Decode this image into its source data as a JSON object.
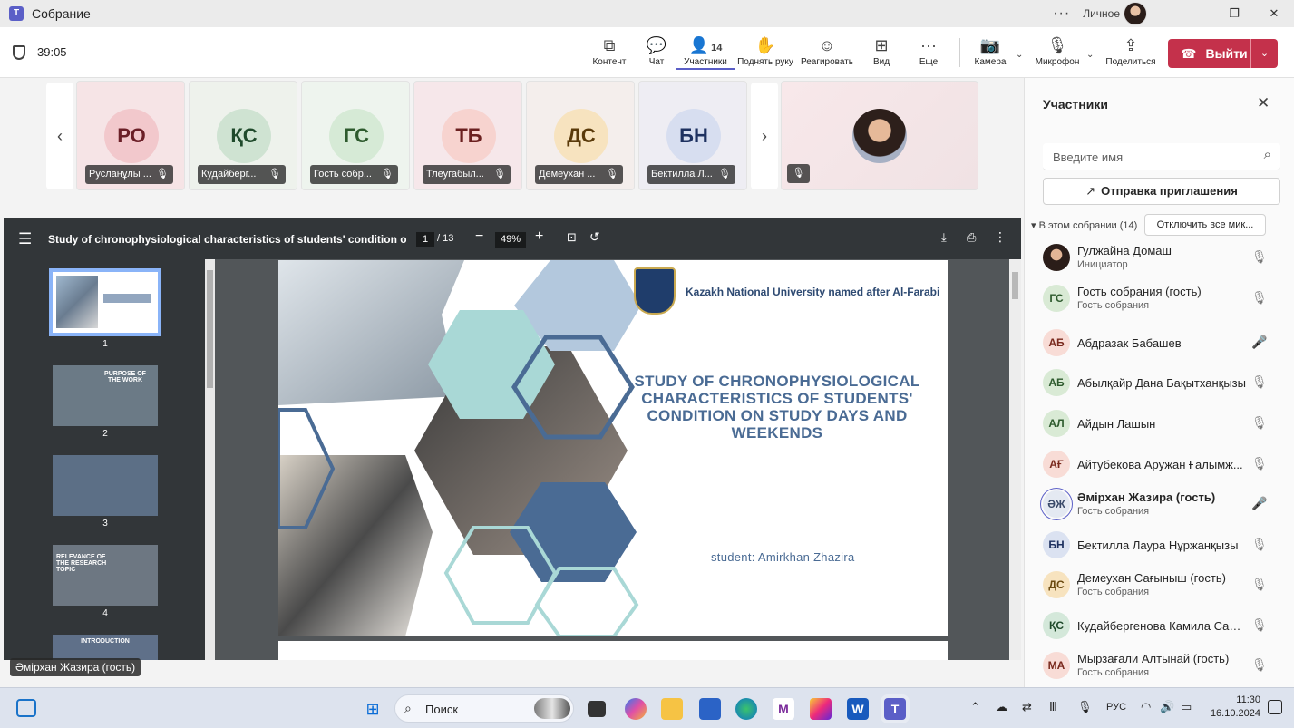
{
  "window": {
    "title": "Собрание",
    "account_label": "Личное"
  },
  "toolbar": {
    "timer": "39:05",
    "tools": [
      {
        "label": "Контент",
        "icon": "share-screen-icon"
      },
      {
        "label": "Чат",
        "icon": "chat-icon"
      },
      {
        "label": "Участники",
        "icon": "people-icon",
        "count": "14"
      },
      {
        "label": "Поднять руку",
        "icon": "hand-icon"
      },
      {
        "label": "Реагировать",
        "icon": "smiley-icon"
      },
      {
        "label": "Вид",
        "icon": "grid-icon"
      },
      {
        "label": "Еще",
        "icon": "more-icon"
      },
      {
        "label": "Камера",
        "icon": "camera-off-icon"
      },
      {
        "label": "Микрофон",
        "icon": "mic-off-icon"
      },
      {
        "label": "Поделиться",
        "icon": "share-icon"
      }
    ],
    "leave_label": "Выйти"
  },
  "video_tiles": [
    {
      "initials": "РО",
      "name": "Русланұлы ...",
      "bg": "#f6e4e6",
      "avatar_bg": "#f2c8cc",
      "avatar_fg": "#6b1f27"
    },
    {
      "initials": "ҚС",
      "name": "Кудайберг...",
      "bg": "#eef2ec",
      "avatar_bg": "#cfe3d2",
      "avatar_fg": "#1f4a2b"
    },
    {
      "initials": "ГС",
      "name": "Гость собр...",
      "bg": "#eef4ee",
      "avatar_bg": "#d6ead6",
      "avatar_fg": "#2e5b2e"
    },
    {
      "initials": "ТБ",
      "name": "Тлеугабыл...",
      "bg": "#f6e7ea",
      "avatar_bg": "#f7d3cf",
      "avatar_fg": "#6b2020"
    },
    {
      "initials": "ДС",
      "name": "Демеухан ...",
      "bg": "#f4eeec",
      "avatar_bg": "#f7e3bf",
      "avatar_fg": "#5a3a0a"
    },
    {
      "initials": "БН",
      "name": "Бектилла Л...",
      "bg": "#eeedf3",
      "avatar_bg": "#d7def0",
      "avatar_fg": "#1e3160"
    }
  ],
  "pdf": {
    "title": "Study of chronophysiological characteristics of students' condition on study ...",
    "current_page": "1",
    "total_pages": "/ 13",
    "zoom": "49%",
    "thumbnails": [
      {
        "num": "1",
        "text": ""
      },
      {
        "num": "2",
        "text": "PURPOSE OF THE WORK"
      },
      {
        "num": "3",
        "text": ""
      },
      {
        "num": "4",
        "text": "RELEVANCE OF THE RESEARCH TOPIC"
      },
      {
        "num": "",
        "text": "INTRODUCTION"
      }
    ],
    "slide": {
      "university": "Kazakh National University named after Al-Farabi",
      "crest_label": "FARABI",
      "title": "STUDY OF CHRONOPHYSIOLOGICAL CHARACTERISTICS OF STUDENTS' CONDITION ON STUDY DAYS AND WEEKENDS",
      "student": "student: Amirkhan Zhazira"
    }
  },
  "caption": "Әмірхан Жазира (гость)",
  "panel": {
    "title": "Участники",
    "search_placeholder": "Введите имя",
    "invite_label": "Отправка приглашения",
    "section_label": "В этом собрании (14)",
    "mute_all_label": "Отключить все мик...",
    "participants": [
      {
        "initials": "",
        "name": "Гулжайна Домаш",
        "role": "Инициатор",
        "mic": "off",
        "photo": true
      },
      {
        "initials": "ГС",
        "name": "Гость собрания (гость)",
        "role": "Гость собрания",
        "mic": "off",
        "bg": "#d9ead5",
        "fg": "#2e5b2e"
      },
      {
        "initials": "АБ",
        "name": "Абдразак Бабашев",
        "role": "",
        "mic": "on",
        "bg": "#f8dcd6",
        "fg": "#7a2a1e"
      },
      {
        "initials": "АБ",
        "name": "Абылқайр Дана Бақытханқызы",
        "role": "",
        "mic": "off",
        "bg": "#d9ead5",
        "fg": "#2e5b2e"
      },
      {
        "initials": "АЛ",
        "name": "Айдын Лашын",
        "role": "",
        "mic": "off",
        "bg": "#d9ead5",
        "fg": "#2e5b2e"
      },
      {
        "initials": "АҒ",
        "name": "Айтубекова Аружан Ғалымж...",
        "role": "",
        "mic": "off",
        "bg": "#f8dcd6",
        "fg": "#7a2a1e"
      },
      {
        "initials": "ӘЖ",
        "name": "Әмірхан Жазира (гость)",
        "role": "Гость собрания",
        "mic": "on",
        "bg": "#e4e9f2",
        "fg": "#3a4a6a",
        "active": true
      },
      {
        "initials": "БН",
        "name": "Бектилла Лаура Нұржанқызы",
        "role": "",
        "mic": "off",
        "bg": "#dbe2f1",
        "fg": "#1e3160"
      },
      {
        "initials": "ДС",
        "name": "Демеухан Сағыныш (гость)",
        "role": "Гость собрания",
        "mic": "off",
        "bg": "#f7e3bf",
        "fg": "#6b4a10"
      },
      {
        "initials": "ҚС",
        "name": "Кудайбергенова Камила Сам...",
        "role": "",
        "mic": "off",
        "bg": "#d4e8da",
        "fg": "#1f4a2b"
      },
      {
        "initials": "МА",
        "name": "Мырзағали Алтынай (гость)",
        "role": "Гость собрания",
        "mic": "off",
        "bg": "#f8dcd6",
        "fg": "#7a2a1e"
      }
    ]
  },
  "taskbar": {
    "search_label": "Поиск",
    "lang": "РУС",
    "time": "11:30",
    "date": "16.10.2024"
  }
}
